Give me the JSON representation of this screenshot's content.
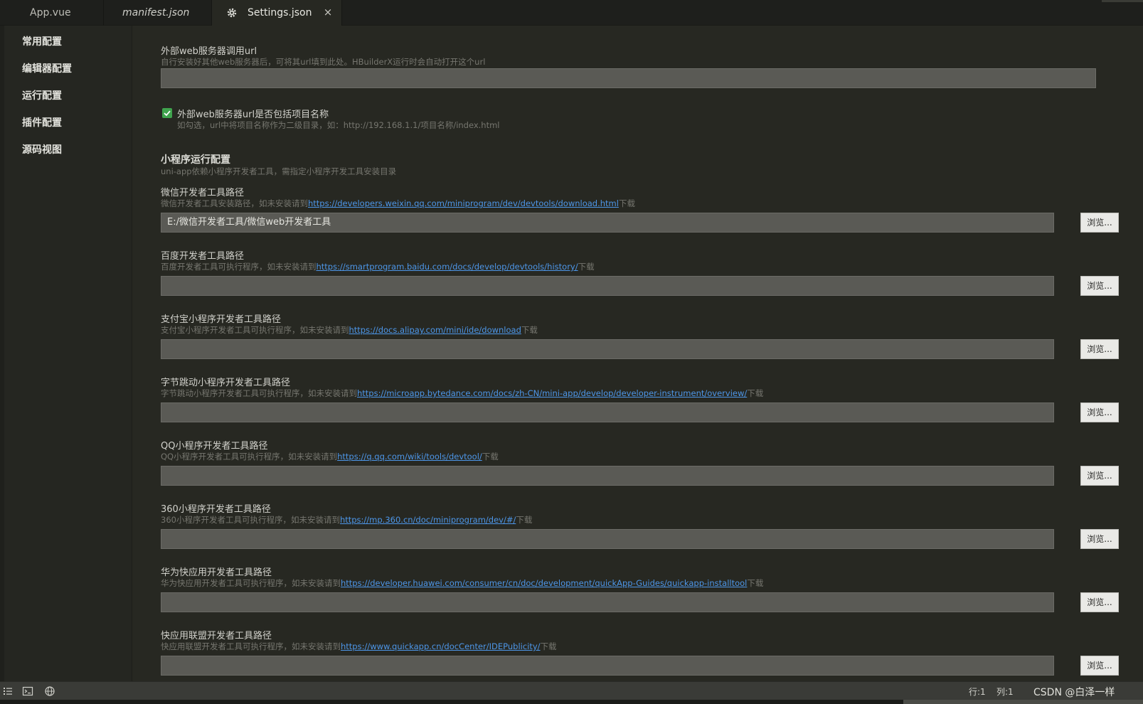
{
  "tabs": [
    {
      "label": "App.vue"
    },
    {
      "label": "manifest.json"
    },
    {
      "label": "Settings.json",
      "close": "×"
    }
  ],
  "sidebar": {
    "items": [
      {
        "label": "常用配置"
      },
      {
        "label": "编辑器配置"
      },
      {
        "label": "运行配置"
      },
      {
        "label": "插件配置"
      },
      {
        "label": "源码视图"
      }
    ]
  },
  "settings": {
    "external_url": {
      "label": "外部web服务器调用url",
      "desc": "自行安装好其他web服务器后，可将其url填到此处。HBuilderX运行时会自动打开这个url",
      "value": ""
    },
    "include_project": {
      "label": "外部web服务器url是否包括项目名称",
      "desc": "如勾选，url中将项目名称作为二级目录，如：http://192.168.1.1/项目名称/index.html",
      "checked": true
    },
    "miniprogram_section": {
      "title": "小程序运行配置",
      "desc": "uni-app依赖小程序开发者工具，需指定小程序开发工具安装目录"
    },
    "tools": [
      {
        "label": "微信开发者工具路径",
        "desc_prefix": "微信开发者工具安装路径，如未安装请到",
        "link": "https://developers.weixin.qq.com/miniprogram/dev/devtools/download.html",
        "desc_suffix": "下载",
        "value": "E:/微信开发者工具/微信web开发者工具",
        "browse": "浏览..."
      },
      {
        "label": "百度开发者工具路径",
        "desc_prefix": "百度开发者工具可执行程序，如未安装请到",
        "link": "https://smartprogram.baidu.com/docs/develop/devtools/history/",
        "desc_suffix": "下载",
        "value": "",
        "browse": "浏览..."
      },
      {
        "label": "支付宝小程序开发者工具路径",
        "desc_prefix": "支付宝小程序开发者工具可执行程序，如未安装请到",
        "link": "https://docs.alipay.com/mini/ide/download",
        "desc_suffix": "下载",
        "value": "",
        "browse": "浏览..."
      },
      {
        "label": "字节跳动小程序开发者工具路径",
        "desc_prefix": "字节跳动小程序开发者工具可执行程序，如未安装请到",
        "link": "https://microapp.bytedance.com/docs/zh-CN/mini-app/develop/developer-instrument/overview/",
        "desc_suffix": "下载",
        "value": "",
        "browse": "浏览..."
      },
      {
        "label": "QQ小程序开发者工具路径",
        "desc_prefix": "QQ小程序开发者工具可执行程序，如未安装请到",
        "link": "https://q.qq.com/wiki/tools/devtool/",
        "desc_suffix": "下载",
        "value": "",
        "browse": "浏览..."
      },
      {
        "label": "360小程序开发者工具路径",
        "desc_prefix": "360小程序开发者工具可执行程序，如未安装请到",
        "link": "https://mp.360.cn/doc/miniprogram/dev/#/",
        "desc_suffix": "下载",
        "value": "",
        "browse": "浏览..."
      },
      {
        "label": "华为快应用开发者工具路径",
        "desc_prefix": "华为快应用开发者工具可执行程序，如未安装请到",
        "link": "https://developer.huawei.com/consumer/cn/doc/development/quickApp-Guides/quickapp-installtool",
        "desc_suffix": "下载",
        "value": "",
        "browse": "浏览..."
      },
      {
        "label": "快应用联盟开发者工具路径",
        "desc_prefix": "快应用联盟开发者工具可执行程序，如未安装请到",
        "link": "https://www.quickapp.cn/docCenter/IDEPublicity/",
        "desc_suffix": "下载",
        "value": "",
        "browse": "浏览..."
      }
    ]
  },
  "statusbar": {
    "line": "行:1",
    "col": "列:1",
    "watermark": "CSDN @白泽一样"
  },
  "colors": {
    "background": "#272822",
    "link": "#4d96e8",
    "checkbox": "#3fa34d"
  },
  "icons": {
    "settings_tab": "gear-icon",
    "statusbar": [
      "list-icon",
      "terminal-icon",
      "globe-icon"
    ]
  }
}
